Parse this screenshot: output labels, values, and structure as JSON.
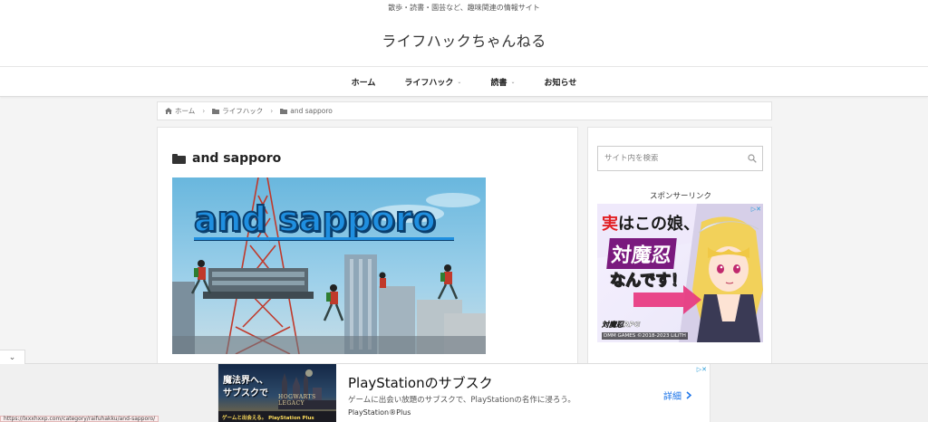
{
  "header": {
    "tagline": "散歩・読書・園芸など、趣味関連の情報サイト",
    "title": "ライフハックちゃんねる"
  },
  "nav": {
    "items": [
      {
        "label": "ホーム",
        "has_caret": false
      },
      {
        "label": "ライフハック",
        "has_caret": true
      },
      {
        "label": "読書",
        "has_caret": true
      },
      {
        "label": "お知らせ",
        "has_caret": false
      }
    ]
  },
  "breadcrumb": {
    "items": [
      {
        "label": "ホーム",
        "icon": "home-icon"
      },
      {
        "label": "ライフハック",
        "icon": "folder-icon"
      },
      {
        "label": "and sapporo",
        "icon": "folder-icon"
      }
    ],
    "separator": "›"
  },
  "main": {
    "title": "and sapporo",
    "eyecatch_text": "and sapporo"
  },
  "sidebar": {
    "search_placeholder": "サイト内を検索",
    "sponsor_label": "スポンサーリンク",
    "ad": {
      "line1_highlight": "実",
      "line1_rest": "はこの娘、",
      "line2": "対魔忍",
      "line3": "なんです！",
      "logo": "対魔忍RPG",
      "footer": "DMM GAMES ©2018-2023 LiLiTH",
      "adchoices": "▷✕"
    }
  },
  "bottom_ad": {
    "thumb_text_1": "魔法界へ、",
    "thumb_text_2": "サブスクで",
    "thumb_logo": "HOGWARTS LEGACY",
    "thumb_footer": "ゲームと出会える。 PlayStation Plus",
    "title": "PlayStationのサブスク",
    "description": "ゲームに出会い放題のサブスクで、PlayStationの名作に浸ろう。",
    "brand": "PlayStation®Plus",
    "cta": "詳細",
    "cta_icon": "chevron-right-icon",
    "adchoices": "▷✕"
  },
  "ui": {
    "collapse_icon": "⌄"
  },
  "status_bar": {
    "url": "https://lxxxhxxp.com/category/raifuhakku/and-sapporo/"
  },
  "colors": {
    "accent_blue": "#1f8fe0",
    "cta_blue": "#1a73e8",
    "ad_red": "#e21e23",
    "ad_purple": "#7a1a7e"
  }
}
